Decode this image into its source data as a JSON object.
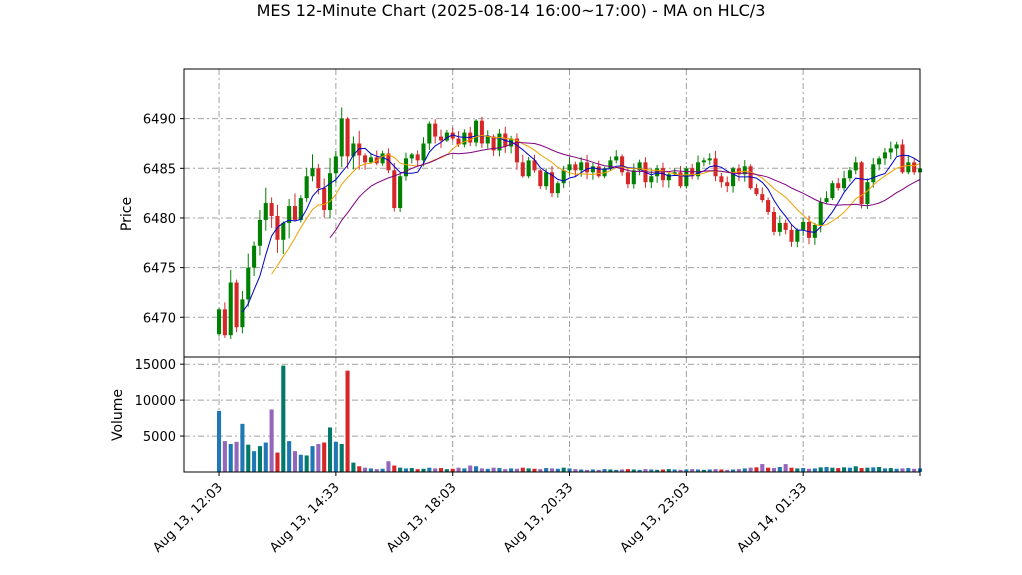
{
  "chart_data": {
    "type": "candlestick",
    "title": "MES 12-Minute Chart (2025-08-14 16:00~17:00) - MA on HLC/3",
    "price_panel": {
      "ylabel": "Price",
      "ylim": [
        6466,
        6495
      ],
      "yticks": [
        6470,
        6475,
        6480,
        6485,
        6490
      ],
      "grid": true
    },
    "volume_panel": {
      "ylabel": "Volume",
      "ylim": [
        0,
        16000
      ],
      "yticks": [
        5000,
        10000,
        15000
      ],
      "grid": true
    },
    "xlim": [
      -6,
      120
    ],
    "xticks": [
      {
        "i": 0,
        "label": "Aug 13, 12:03"
      },
      {
        "i": 20,
        "label": "Aug 13, 14:33"
      },
      {
        "i": 40,
        "label": "Aug 13, 18:03"
      },
      {
        "i": 60,
        "label": "Aug 13, 20:33"
      },
      {
        "i": 80,
        "label": "Aug 13, 23:03"
      },
      {
        "i": 100,
        "label": "Aug 14, 01:33"
      },
      {
        "i": 120,
        "label": ""
      }
    ],
    "closes": [
      6470.8,
      6468.2,
      6473.5,
      6469.0,
      6471.8,
      6475.0,
      6477.2,
      6479.8,
      6481.5,
      6480.2,
      6477.8,
      6479.5,
      6481.2,
      6479.8,
      6482.0,
      6484.2,
      6485.0,
      6483.0,
      6480.8,
      6484.5,
      6486.2,
      6490.0,
      6486.2,
      6487.5,
      6486.3,
      6485.6,
      6486.1,
      6485.5,
      6486.5,
      6484.8,
      6481.0,
      6484.2,
      6486.0,
      6486.4,
      6485.8,
      6487.5,
      6489.5,
      6488.2,
      6487.8,
      6488.6,
      6488.0,
      6487.4,
      6488.6,
      6487.6,
      6489.8,
      6487.5,
      6488.2,
      6486.8,
      6488.5,
      6487.2,
      6488.0,
      6485.6,
      6484.2,
      6485.8,
      6484.8,
      6483.2,
      6484.6,
      6482.5,
      6483.5,
      6484.8,
      6485.4,
      6484.8,
      6485.6,
      6484.6,
      6485.2,
      6484.2,
      6485.0,
      6485.8,
      6486.2,
      6484.6,
      6483.4,
      6484.8,
      6485.6,
      6483.6,
      6484.2,
      6485.0,
      6483.8,
      6484.4,
      6484.6,
      6483.2,
      6485.0,
      6484.2,
      6485.6,
      6485.8,
      6486.0,
      6484.2,
      6483.6,
      6483.2,
      6485.0,
      6484.4,
      6485.2,
      6483.0,
      6482.4,
      6481.8,
      6480.6,
      6478.6,
      6479.5,
      6478.8,
      6477.6,
      6478.8,
      6479.6,
      6478.0,
      6479.3,
      6481.6,
      6482.0,
      6483.5,
      6483.0,
      6484.0,
      6484.8,
      6485.6,
      6481.4,
      6483.6,
      6485.4,
      6486.0,
      6486.6,
      6487.0,
      6487.4,
      6484.6,
      6485.6,
      6484.6,
      6485.0
    ],
    "volumes": [
      8500,
      4300,
      3900,
      4200,
      6700,
      3800,
      2900,
      3600,
      4100,
      8700,
      2700,
      14800,
      4300,
      2900,
      2400,
      2300,
      3600,
      3900,
      4100,
      6200,
      4200,
      3900,
      14100,
      1300,
      800,
      600,
      500,
      400,
      450,
      1500,
      900,
      600,
      500,
      550,
      400,
      450,
      600,
      500,
      550,
      400,
      450,
      600,
      500,
      900,
      800,
      500,
      450,
      600,
      550,
      400,
      500,
      450,
      600,
      500,
      450,
      400,
      550,
      500,
      450,
      600,
      500,
      400,
      350,
      300,
      350,
      300,
      400,
      350,
      300,
      350,
      400,
      350,
      300,
      400,
      350,
      300,
      350,
      400,
      350,
      300,
      350,
      400,
      350,
      300,
      350,
      400,
      350,
      300,
      350,
      400,
      500,
      600,
      650,
      1100,
      600,
      550,
      700,
      1100,
      600,
      500,
      550,
      450,
      500,
      650,
      700,
      600,
      550,
      650,
      600,
      800,
      550,
      600,
      650,
      700,
      500,
      550,
      450,
      500,
      550,
      450,
      500
    ],
    "series": [
      {
        "color": "#0000cc"
      },
      {
        "color": "#f0a000"
      },
      {
        "color": "#800080"
      }
    ],
    "up_color": "#008000",
    "down_color": "#d62728"
  }
}
